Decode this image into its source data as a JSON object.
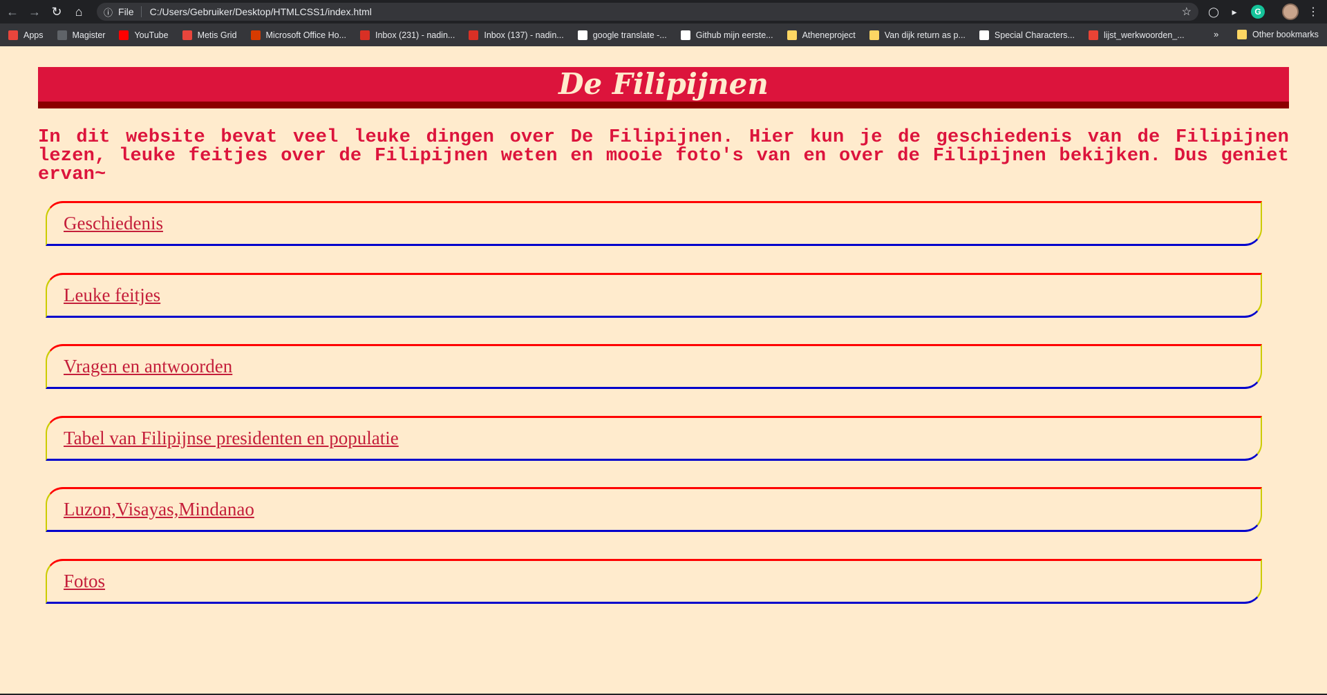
{
  "browser": {
    "scheme": "File",
    "url": "C:/Users/Gebruiker/Desktop/HTMLCSS1/index.html",
    "bookmarks": [
      {
        "label": "Apps",
        "icon": "apps-grid-icon",
        "color": "#e8453c"
      },
      {
        "label": "Magister",
        "icon": "magister-icon",
        "color": "#5f6368"
      },
      {
        "label": "YouTube",
        "icon": "youtube-icon",
        "color": "#ff0000"
      },
      {
        "label": "Metis Grid",
        "icon": "metis-icon",
        "color": "#e8453c"
      },
      {
        "label": "Microsoft Office Ho...",
        "icon": "office-icon",
        "color": "#d83b01"
      },
      {
        "label": "Inbox (231) - nadin...",
        "icon": "gmail-icon",
        "color": "#d93025"
      },
      {
        "label": "Inbox (137) - nadin...",
        "icon": "gmail-icon",
        "color": "#d93025"
      },
      {
        "label": "google translate -...",
        "icon": "google-icon",
        "color": "#ffffff"
      },
      {
        "label": "Github mijn eerste...",
        "icon": "github-icon",
        "color": "#ffffff"
      },
      {
        "label": "Atheneproject",
        "icon": "folder-icon",
        "color": "#fdd663"
      },
      {
        "label": "Van dijk return as p...",
        "icon": "folder-icon",
        "color": "#fdd663"
      },
      {
        "label": "Special Characters...",
        "icon": "globe-icon",
        "color": "#ffffff"
      },
      {
        "label": "lijst_werkwoorden_...",
        "icon": "pin-icon",
        "color": "#ea4335"
      }
    ],
    "other_bookmarks": "Other bookmarks"
  },
  "page": {
    "title": "De Filipijnen",
    "intro": "In dit website bevat veel leuke dingen over De Filipijnen. Hier kun je de geschiedenis van de Filipijnen lezen, leuke feitjes over de Filipijnen weten en mooie foto's van en over de Filipijnen bekijken. Dus geniet ervan~",
    "links": [
      "Geschiedenis",
      "Leuke feitjes",
      "Vragen en antwoorden",
      "Tabel van Filipijnse presidenten en populatie",
      "Luzon,Visayas,Mindanao",
      "Fotos"
    ]
  },
  "colors": {
    "background": "#FFEBCD",
    "header": "#DC143C",
    "header_border": "#8B0000",
    "text": "#DC143C"
  }
}
